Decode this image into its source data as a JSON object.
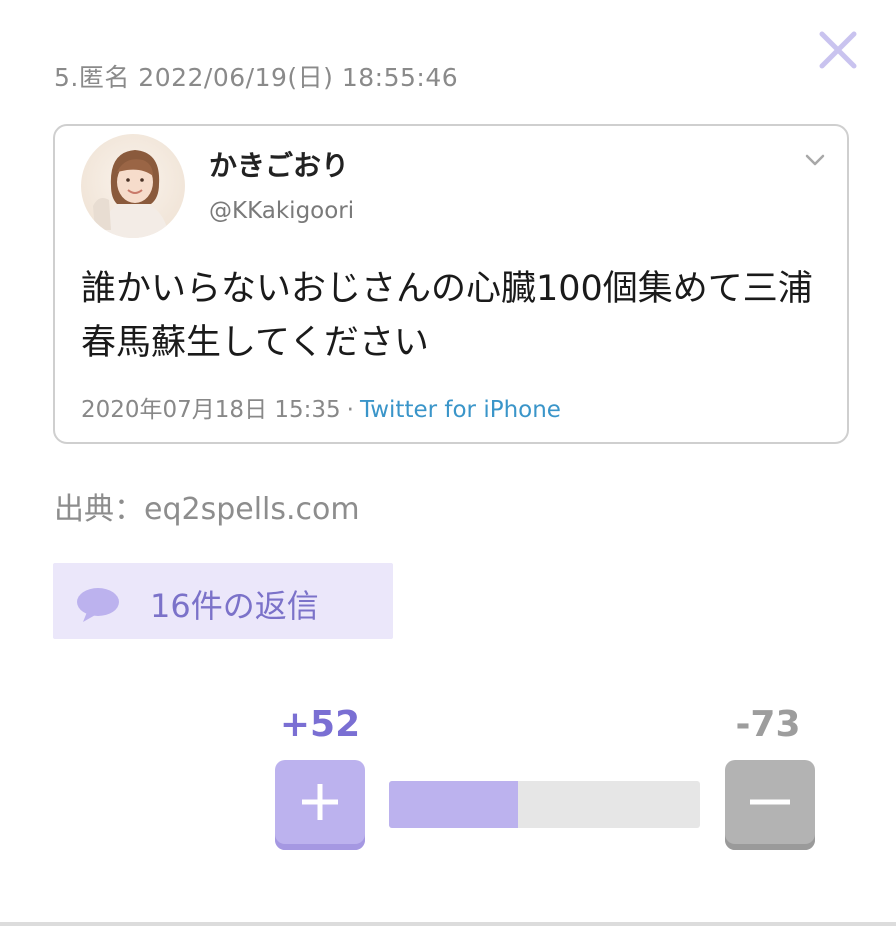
{
  "post": {
    "meta": "5.匿名 2022/06/19(日) 18:55:46"
  },
  "tweet": {
    "display_name": "かきごおり",
    "handle": "@KKakigoori",
    "text": "誰かいらないおじさんの心臓100個集めて三浦春馬蘇生してください",
    "date": "2020年07月18日 15:35",
    "separator": "·",
    "source": "Twitter for iPhone"
  },
  "source_line": "出典：eq2spells.com",
  "replies": {
    "label": "16件の返信"
  },
  "votes": {
    "plus": "+52",
    "minus": "-73",
    "plus_fraction": 0.416
  },
  "icons": {
    "close": "close-icon",
    "chevron": "chevron-down-icon",
    "reply": "speech-bubble-icon",
    "plus": "plus-icon",
    "minus": "minus-icon"
  },
  "colors": {
    "accent": "#7a6fd3",
    "accent_light": "#bcb2ee",
    "reply_bg": "#ebe7fa",
    "link": "#3a95c9",
    "minus": "#b3b3b3"
  }
}
